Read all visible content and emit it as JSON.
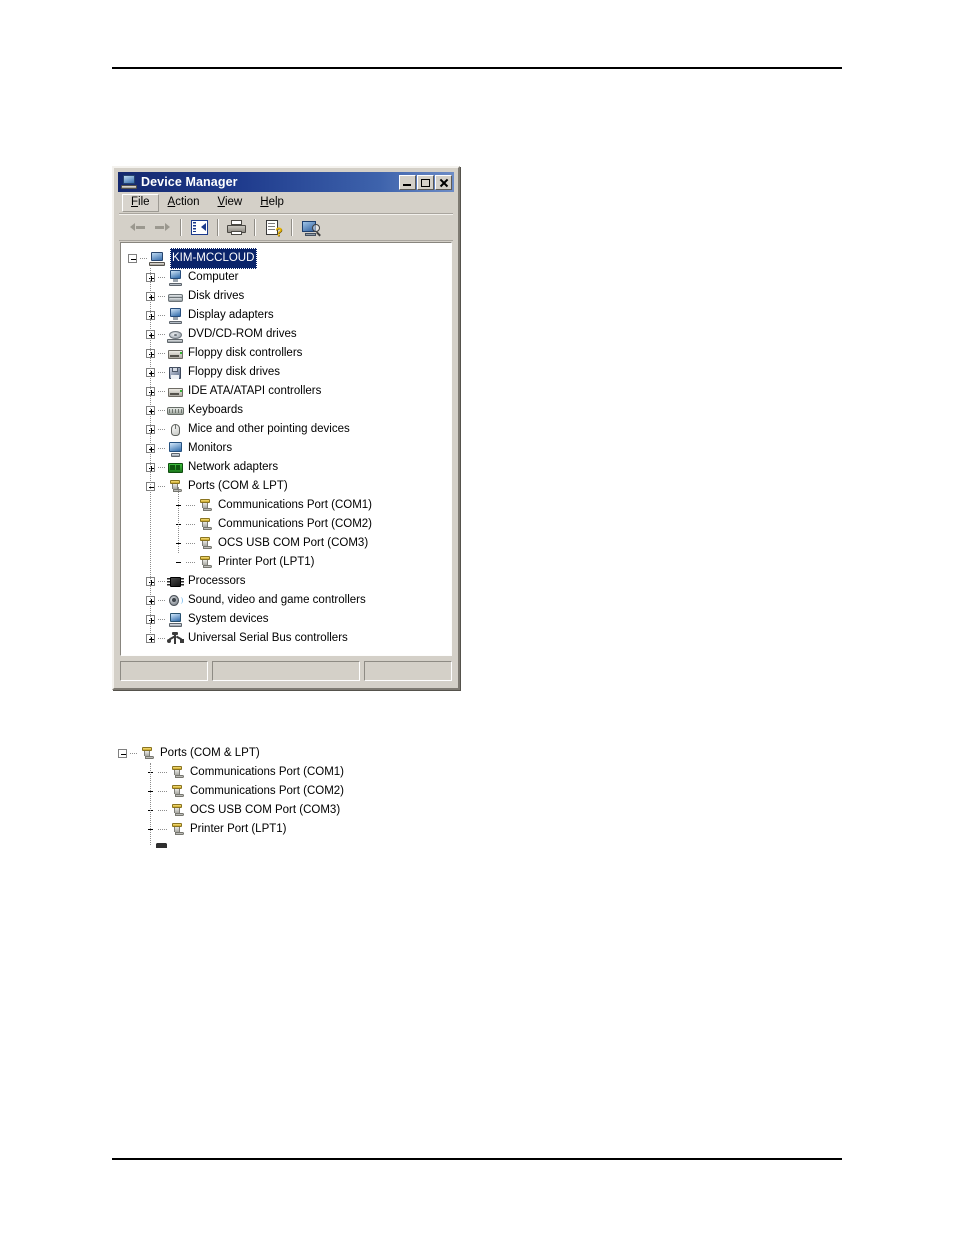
{
  "window": {
    "title": "Device Manager",
    "title_icon": "computer-icon",
    "controls": {
      "minimize": "minimize-button",
      "maximize": "maximize-button",
      "close": "close-button"
    }
  },
  "menu": {
    "items": [
      {
        "label": "File",
        "accel": "F",
        "active": true
      },
      {
        "label": "Action",
        "accel": "A",
        "active": false
      },
      {
        "label": "View",
        "accel": "V",
        "active": false
      },
      {
        "label": "Help",
        "accel": "H",
        "active": false
      }
    ]
  },
  "toolbar": {
    "buttons": [
      {
        "name": "back-button",
        "icon": "arrow-left-icon",
        "enabled": false
      },
      {
        "name": "forward-button",
        "icon": "arrow-right-icon",
        "enabled": false
      },
      {
        "name": "show-hide-console-tree-button",
        "icon": "properties-panel-icon",
        "enabled": true
      },
      {
        "name": "print-button",
        "icon": "printer-icon",
        "enabled": true
      },
      {
        "name": "properties-button",
        "icon": "help-properties-icon",
        "enabled": true
      },
      {
        "name": "scan-for-hardware-changes-button",
        "icon": "scan-hardware-icon",
        "enabled": true
      }
    ]
  },
  "tree": {
    "root": {
      "label": "KIM-MCCLOUD",
      "icon": "computer-root-icon",
      "selected": true,
      "expanded": true
    },
    "nodes": [
      {
        "label": "Computer",
        "icon": "computer-icon",
        "expanded": false,
        "level": 1
      },
      {
        "label": "Disk drives",
        "icon": "disk-drive-icon",
        "expanded": false,
        "level": 1
      },
      {
        "label": "Display adapters",
        "icon": "display-adapter-icon",
        "expanded": false,
        "level": 1
      },
      {
        "label": "DVD/CD-ROM drives",
        "icon": "dvd-cdrom-icon",
        "expanded": false,
        "level": 1
      },
      {
        "label": "Floppy disk controllers",
        "icon": "floppy-controller-icon",
        "expanded": false,
        "level": 1
      },
      {
        "label": "Floppy disk drives",
        "icon": "floppy-drive-icon",
        "expanded": false,
        "level": 1
      },
      {
        "label": "IDE ATA/ATAPI controllers",
        "icon": "ide-controller-icon",
        "expanded": false,
        "level": 1
      },
      {
        "label": "Keyboards",
        "icon": "keyboard-icon",
        "expanded": false,
        "level": 1
      },
      {
        "label": "Mice and other pointing devices",
        "icon": "mouse-icon",
        "expanded": false,
        "level": 1
      },
      {
        "label": "Monitors",
        "icon": "monitor-icon",
        "expanded": false,
        "level": 1
      },
      {
        "label": "Network adapters",
        "icon": "network-adapter-icon",
        "expanded": false,
        "level": 1
      },
      {
        "label": "Ports (COM & LPT)",
        "icon": "port-icon",
        "expanded": true,
        "level": 1
      },
      {
        "label": "Communications Port (COM1)",
        "icon": "port-icon",
        "leaf": true,
        "level": 2
      },
      {
        "label": "Communications Port (COM2)",
        "icon": "port-icon",
        "leaf": true,
        "level": 2
      },
      {
        "label": "OCS USB COM Port (COM3)",
        "icon": "port-icon",
        "leaf": true,
        "level": 2
      },
      {
        "label": "Printer Port (LPT1)",
        "icon": "port-icon",
        "leaf": true,
        "level": 2
      },
      {
        "label": "Processors",
        "icon": "processor-icon",
        "expanded": false,
        "level": 1
      },
      {
        "label": "Sound, video and game controllers",
        "icon": "sound-controller-icon",
        "expanded": false,
        "level": 1
      },
      {
        "label": "System devices",
        "icon": "system-device-icon",
        "expanded": false,
        "level": 1
      },
      {
        "label": "Universal Serial Bus controllers",
        "icon": "usb-controller-icon",
        "expanded": false,
        "level": 1
      }
    ]
  },
  "statusbar": {
    "panes": [
      "",
      "",
      ""
    ]
  },
  "fragment": {
    "nodes": [
      {
        "label": "Ports (COM & LPT)",
        "icon": "port-icon",
        "expanded": true,
        "level": 0
      },
      {
        "label": "Communications Port (COM1)",
        "icon": "port-icon",
        "leaf": true,
        "level": 1
      },
      {
        "label": "Communications Port (COM2)",
        "icon": "port-icon",
        "leaf": true,
        "level": 1
      },
      {
        "label": "OCS USB COM Port (COM3)",
        "icon": "port-icon",
        "leaf": true,
        "level": 1
      },
      {
        "label": "Printer Port (LPT1)",
        "icon": "port-icon",
        "leaf": true,
        "level": 1
      }
    ]
  },
  "colors": {
    "titlebar_start": "#14286e",
    "titlebar_end": "#6d8cc6",
    "window_face": "#d4d0c8",
    "selection": "#0a246a",
    "tree_background": "#ffffff"
  }
}
